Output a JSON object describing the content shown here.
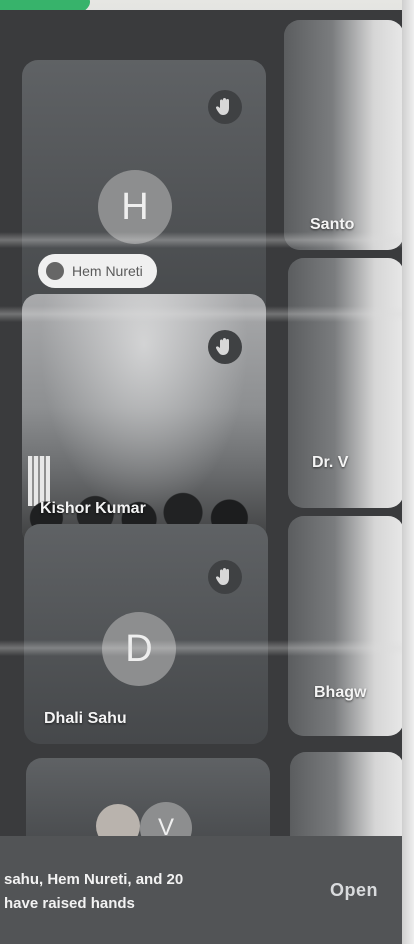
{
  "participants": [
    {
      "name": "",
      "initial": "H",
      "chip_label": "Hem Nureti",
      "hand_raised": true,
      "video": false
    },
    {
      "name": "Santo",
      "video": true
    },
    {
      "name": "Kishor Kumar",
      "hand_raised": true,
      "video": true
    },
    {
      "name": "Dr. V",
      "video": true
    },
    {
      "name": "Dhali Sahu",
      "initial": "D",
      "hand_raised": true,
      "video": false
    },
    {
      "name": "Bhagw",
      "video": true
    },
    {
      "name": "",
      "initial": "V",
      "video": false
    }
  ],
  "raised_hands_banner": {
    "line1": "sahu, Hem Nureti, and 20",
    "line2": "have raised hands",
    "action": "Open"
  },
  "icons": {
    "hand": "raised-hand-icon"
  },
  "colors": {
    "tile": "#55585b",
    "avatar": "#8d8e8f",
    "banner": "#525456",
    "accent_green": "#37b36b"
  }
}
